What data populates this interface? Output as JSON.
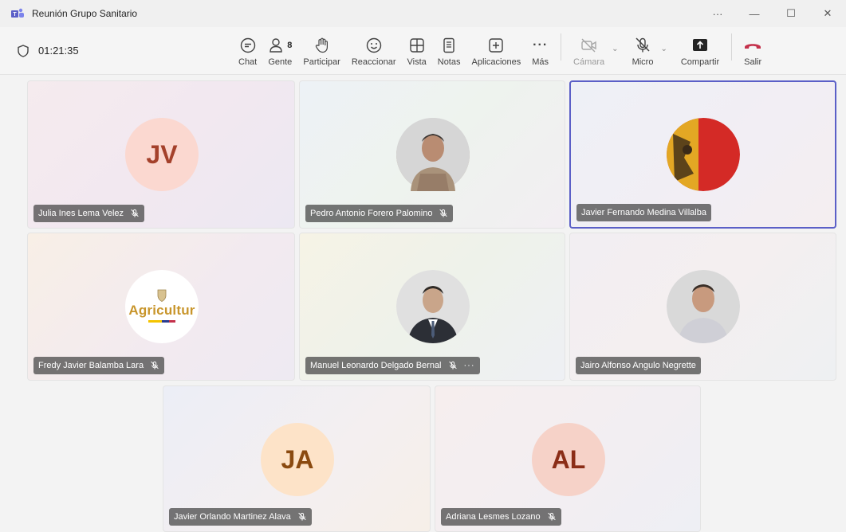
{
  "window": {
    "title": "Reunión Grupo Sanitario",
    "more": "···",
    "minimize": "—",
    "maximize": "☐",
    "close": "✕"
  },
  "toolbar": {
    "timer": "01:21:35",
    "people_count": "8",
    "items": {
      "chat": "Chat",
      "people": "Gente",
      "raise": "Participar",
      "react": "Reaccionar",
      "view": "Vista",
      "notes": "Notas",
      "apps": "Aplicaciones",
      "more": "Más",
      "camera": "Cámara",
      "mic": "Micro",
      "share": "Compartir",
      "leave": "Salir"
    },
    "more_glyph": "···",
    "caret": "⌄"
  },
  "participants": [
    {
      "name": "Julia Ines Lema Velez",
      "initials": "JV",
      "muted": true
    },
    {
      "name": "Pedro Antonio Forero Palomino",
      "initials": "",
      "muted": true
    },
    {
      "name": "Javier Fernando Medina Villalba",
      "initials": "",
      "muted": false,
      "active": true
    },
    {
      "name": "Fredy Javier Balamba Lara",
      "initials": "",
      "muted": true,
      "avatar_text": "Agricultur"
    },
    {
      "name": "Manuel Leonardo Delgado Bernal",
      "initials": "",
      "muted": true,
      "more": "···"
    },
    {
      "name": "Jairo Alfonso Angulo Negrette",
      "initials": "",
      "muted": false
    },
    {
      "name": "Javier Orlando Martinez Alava",
      "initials": "JA",
      "muted": true
    },
    {
      "name": "Adriana Lesmes Lozano",
      "initials": "AL",
      "muted": true
    }
  ],
  "colors": {
    "accent": "#5b5fc7",
    "leave": "#c4314b",
    "jv_bg": "#fbd8d0",
    "jv_fg": "#a4412b",
    "ja_bg": "#fde3c8",
    "ja_fg": "#8a4a10",
    "al_bg": "#f6d2c8",
    "al_fg": "#8b2d17"
  }
}
